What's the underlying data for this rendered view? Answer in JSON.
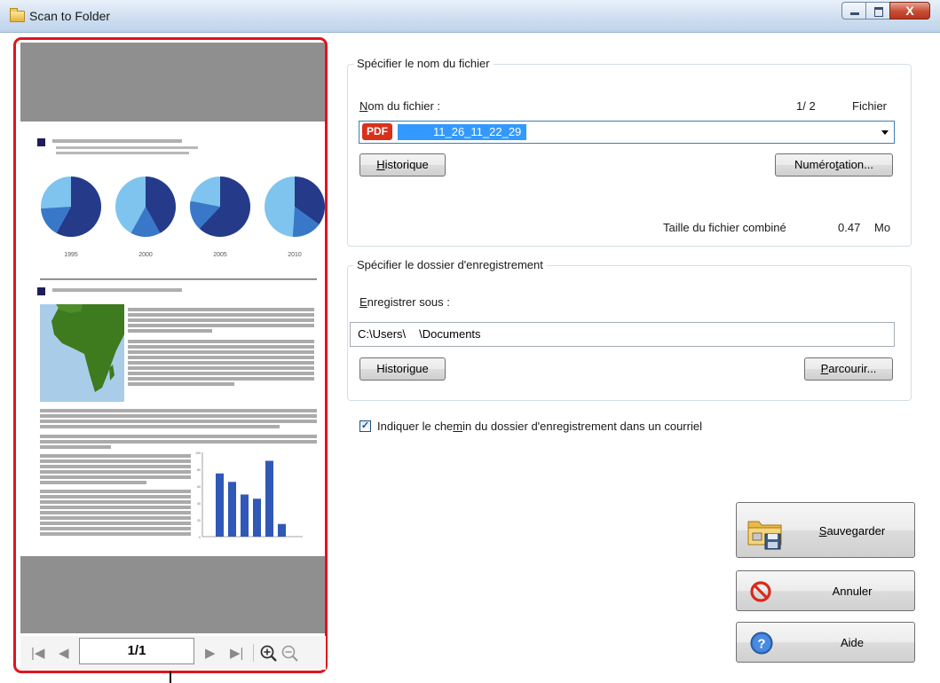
{
  "window": {
    "title": "Scan to Folder",
    "close_glyph": "X"
  },
  "preview": {
    "page_indicator": "1/1",
    "pie_years": [
      "1995",
      "2000",
      "2005",
      "2010"
    ],
    "pie_fractions": [
      0.58,
      0.42,
      0.62,
      0.35
    ],
    "bar_values": [
      75,
      65,
      50,
      45,
      90,
      15
    ],
    "bar_axis_ticks": [
      "100",
      "80",
      "60",
      "40",
      "20",
      "0"
    ]
  },
  "file_group": {
    "legend": "Spécifier le nom du fichier",
    "name_label_key": "N",
    "name_label_rest": "om du fichier :",
    "count": "1/ 2",
    "count_unit": "Fichier",
    "format_badge": "PDF",
    "filename": "11_26_11_22_29",
    "history_key": "H",
    "history_rest": "istorique",
    "numbering_pre": "Numéro",
    "numbering_key": "t",
    "numbering_post": "ation...",
    "size_label": "Taille du fichier combiné",
    "size_value": "0.47",
    "size_unit": "Mo"
  },
  "folder_group": {
    "legend": "Spécifier le dossier d'enregistrement",
    "save_label_key": "E",
    "save_label_rest": "nregistrer sous :",
    "path_start": "C:\\Users\\",
    "path_end": "\\Documents",
    "history_pre": "Histori",
    "history_key": "g",
    "history_post": "ue",
    "browse_key": "P",
    "browse_rest": "arcourir..."
  },
  "email_option": {
    "checked": true,
    "label_pre": "Indiquer le che",
    "label_key": "m",
    "label_post": "in du dossier d'enregistrement dans un courriel"
  },
  "actions": {
    "save_key": "S",
    "save_rest": "auvegarder",
    "cancel_label": "Annuler",
    "help_label": "Aide"
  },
  "colors": {
    "highlight": "#e0141e",
    "selection": "#3399ff",
    "pdf_badge": "#d8311b"
  }
}
